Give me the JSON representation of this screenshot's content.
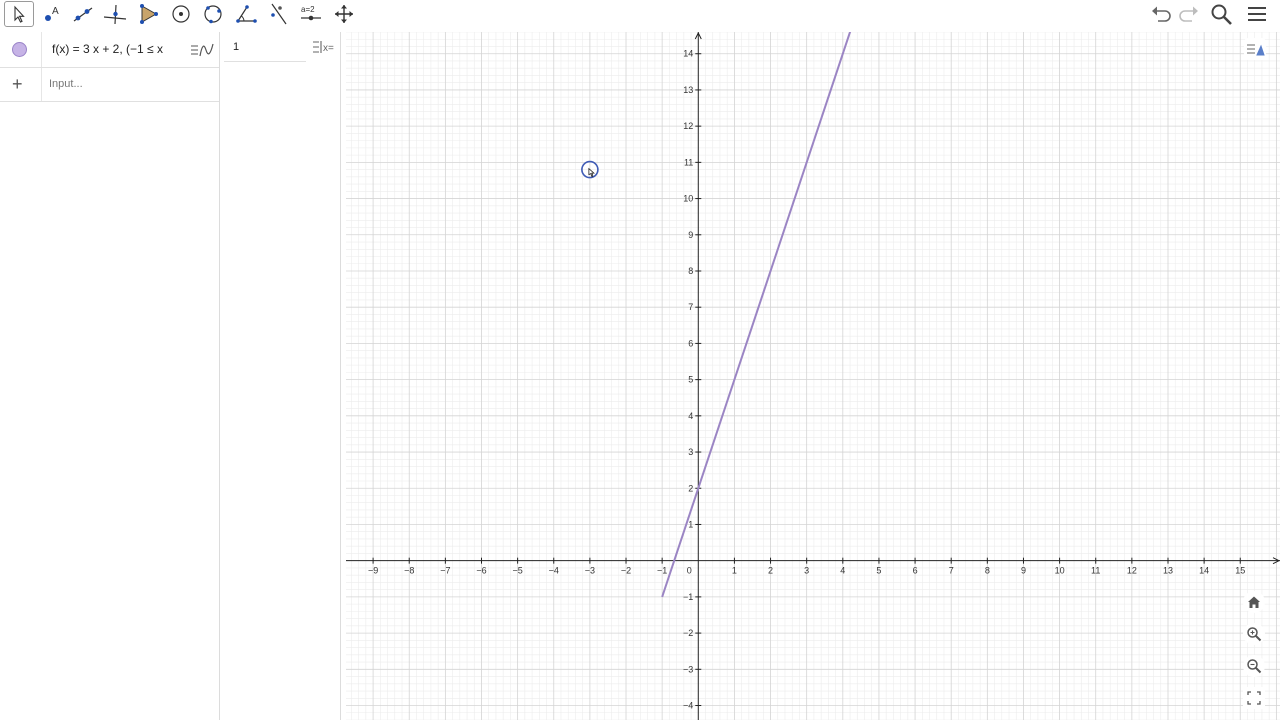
{
  "toolbar": {
    "tools": [
      {
        "name": "move-tool",
        "icon": "arrow-cursor-icon"
      },
      {
        "name": "point-tool",
        "icon": "point-icon",
        "label": "A"
      },
      {
        "name": "line-tool",
        "icon": "line-icon"
      },
      {
        "name": "perpendicular-line-tool",
        "icon": "perpendicular-icon"
      },
      {
        "name": "polygon-tool",
        "icon": "polygon-icon"
      },
      {
        "name": "circle-center-point-tool",
        "icon": "circle-icon"
      },
      {
        "name": "circle-three-points-tool",
        "icon": "circle-three-points-icon"
      },
      {
        "name": "angle-tool",
        "icon": "angle-icon"
      },
      {
        "name": "reflect-tool",
        "icon": "reflect-icon"
      },
      {
        "name": "slider-tool",
        "icon": "slider-icon",
        "label": "a=2"
      },
      {
        "name": "move-graphics-tool",
        "icon": "move-arrows-icon"
      }
    ],
    "right": [
      "undo-icon",
      "redo-icon",
      "search-icon",
      "menu-icon"
    ]
  },
  "algebra": {
    "expression": "f(x) = 3 x + 2,   (−1 ≤ x",
    "input_placeholder": "Input..."
  },
  "table": {
    "first_value": "1"
  },
  "graph": {
    "x_min": -9.75,
    "x_max": 16.1,
    "y_min": -4.4,
    "y_max": 14.6,
    "x_ticks": [
      "−9",
      "−8",
      "−7",
      "−6",
      "−5",
      "−4",
      "−3",
      "−2",
      "−1",
      "0",
      "1",
      "2",
      "3",
      "4",
      "5",
      "6",
      "7",
      "8",
      "9",
      "10",
      "11",
      "12",
      "13",
      "14",
      "15"
    ],
    "y_ticks": [
      "−4",
      "−3",
      "−2",
      "−1",
      "1",
      "2",
      "3",
      "4",
      "5",
      "6",
      "7",
      "8",
      "9",
      "10",
      "11",
      "12",
      "13",
      "14"
    ],
    "function": {
      "slope": 3,
      "intercept": 2,
      "domain_start": -1,
      "color": "#9b85c4"
    },
    "cursor_point": {
      "x": -3,
      "y": 10.8
    }
  },
  "colors": {
    "grid_minor": "#ececec",
    "grid_major": "#d4d4d4",
    "axis": "#222222",
    "function": "#9b85c4"
  }
}
